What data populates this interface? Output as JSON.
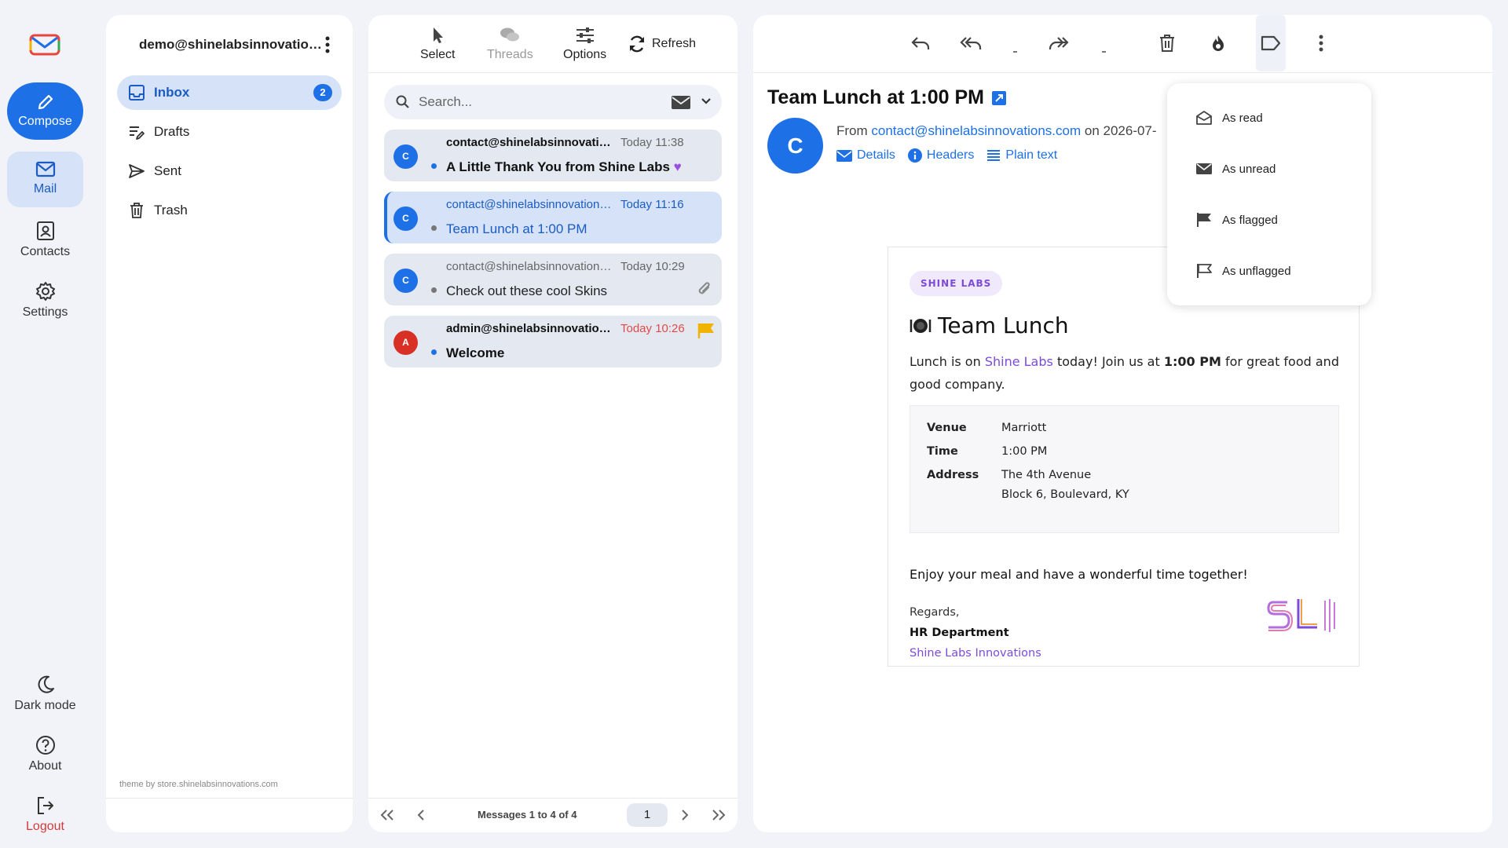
{
  "rail": {
    "compose": "Compose",
    "mail": "Mail",
    "contacts": "Contacts",
    "settings": "Settings",
    "dark_mode": "Dark mode",
    "about": "About",
    "logout": "Logout"
  },
  "account": {
    "email": "demo@shinelabsinnovations.com"
  },
  "folders": [
    {
      "name": "Inbox",
      "icon": "inbox-icon",
      "unread": "2"
    },
    {
      "name": "Drafts",
      "icon": "drafts-icon"
    },
    {
      "name": "Sent",
      "icon": "sent-icon"
    },
    {
      "name": "Trash",
      "icon": "trash-icon"
    }
  ],
  "theme_note": "theme by store.shinelabsinnovations.com",
  "toolbar": {
    "select": "Select",
    "threads": "Threads",
    "options": "Options",
    "refresh": "Refresh"
  },
  "search": {
    "placeholder": "Search..."
  },
  "messages": [
    {
      "avatar": "C",
      "from": "contact@shinelabsinnovations.com",
      "time": "Today 11:38",
      "subject": "A Little Thank You from Shine Labs",
      "state": "unread"
    },
    {
      "avatar": "C",
      "from": "contact@shinelabsinnovations.com",
      "time": "Today 11:16",
      "subject": "Team Lunch at 1:00 PM",
      "state": "selected"
    },
    {
      "avatar": "C",
      "from": "contact@shinelabsinnovations.com",
      "time": "Today 10:29",
      "subject": "Check out these cool Skins",
      "state": "read",
      "attachment": true
    },
    {
      "avatar": "A",
      "from": "admin@shinelabsinnovations.com",
      "time": "Today 10:26",
      "subject": "Welcome",
      "state": "unread",
      "flagged": true
    }
  ],
  "pager": {
    "count": "Messages 1 to 4 of 4",
    "page": "1"
  },
  "reader": {
    "subject": "Team Lunch at 1:00 PM",
    "avatar": "C",
    "from_prefix": "From ",
    "from_email": "contact@shinelabsinnovations.com",
    "from_suffix": " on 2026-07-",
    "details": "Details",
    "headers": "Headers",
    "plain_text": "Plain text"
  },
  "email": {
    "pill": "SHINE LABS",
    "heading": "Team Lunch",
    "intro_1": "Lunch is on ",
    "intro_link": "Shine Labs",
    "intro_2": " today! Join us at ",
    "intro_time": "1:00 PM",
    "intro_3": " for great food and good company.",
    "venue_label": "Venue",
    "venue": "Marriott",
    "time_label": "Time",
    "time": "1:00 PM",
    "address_label": "Address",
    "address_1": "The 4th Avenue",
    "address_2": "Block 6, Boulevard, KY",
    "enjoy": "Enjoy your meal and have a wonderful time together!",
    "regards": "Regards,",
    "dept": "HR Department",
    "company": "Shine Labs Innovations"
  },
  "mark_menu": {
    "as_read": "As read",
    "as_unread": "As unread",
    "as_flagged": "As flagged",
    "as_unflagged": "As unflagged"
  },
  "colors": {
    "accent": "#1d70e6",
    "purple": "#7c4bd9",
    "flag": "#f0b400",
    "avatar_red": "#d93025",
    "logout": "#d43a3a"
  }
}
